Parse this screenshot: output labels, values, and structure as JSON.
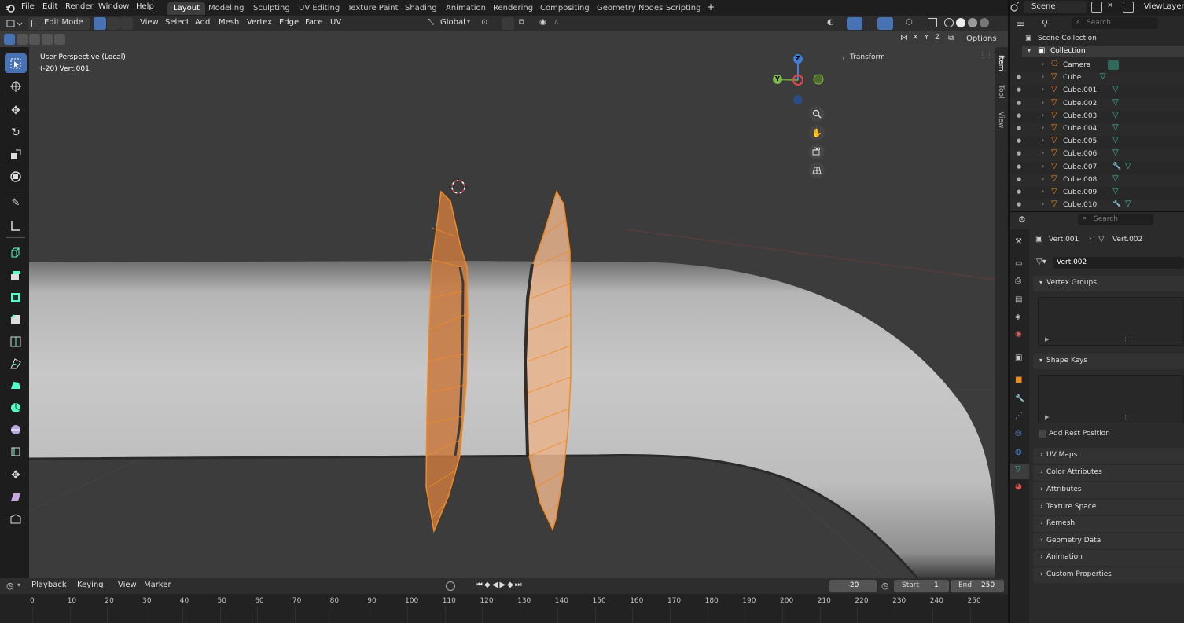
{
  "topbar": {
    "menus": [
      "File",
      "Edit",
      "Render",
      "Window",
      "Help"
    ],
    "workspaces": [
      "Layout",
      "Modeling",
      "Sculpting",
      "UV Editing",
      "Texture Paint",
      "Shading",
      "Animation",
      "Rendering",
      "Compositing",
      "Geometry Nodes",
      "Scripting"
    ],
    "active_workspace": "Layout",
    "add_workspace": "+",
    "scene": "Scene",
    "view_layer": "ViewLayer"
  },
  "viewport_header": {
    "mode": "Edit Mode",
    "menus": [
      "View",
      "Select",
      "Add",
      "Mesh",
      "Vertex",
      "Edge",
      "Face",
      "UV"
    ],
    "orientation": "Global",
    "options": "Options",
    "axes": [
      "X",
      "Y",
      "Z"
    ]
  },
  "viewport": {
    "perspective": "User Perspective (Local)",
    "object_info": "(-20) Vert.001",
    "gizmo": {
      "z": "Z",
      "y": "Y"
    },
    "npanel_section": "Transform",
    "npanel_tabs": [
      "Item",
      "Tool",
      "View"
    ]
  },
  "timeline": {
    "menus": [
      "Playback",
      "Keying",
      "View",
      "Marker"
    ],
    "current_frame": "-20",
    "start_label": "Start",
    "start": "1",
    "end_label": "End",
    "end": "250",
    "ticks": [
      "0",
      "10",
      "20",
      "30",
      "40",
      "50",
      "60",
      "70",
      "80",
      "90",
      "100",
      "110",
      "120",
      "130",
      "140",
      "150",
      "160",
      "170",
      "180",
      "190",
      "200",
      "210",
      "220",
      "230",
      "240",
      "250"
    ]
  },
  "outliner": {
    "search_placeholder": "Search",
    "scene_collection": "Scene Collection",
    "collection": "Collection",
    "items": [
      {
        "name": "Camera",
        "kind": "camera"
      },
      {
        "name": "Cube",
        "kind": "mesh"
      },
      {
        "name": "Cube.001",
        "kind": "mesh"
      },
      {
        "name": "Cube.002",
        "kind": "mesh"
      },
      {
        "name": "Cube.003",
        "kind": "mesh"
      },
      {
        "name": "Cube.004",
        "kind": "mesh"
      },
      {
        "name": "Cube.005",
        "kind": "mesh"
      },
      {
        "name": "Cube.006",
        "kind": "mesh"
      },
      {
        "name": "Cube.007",
        "kind": "mesh-mod"
      },
      {
        "name": "Cube.008",
        "kind": "mesh"
      },
      {
        "name": "Cube.009",
        "kind": "mesh"
      },
      {
        "name": "Cube.010",
        "kind": "mesh-mod"
      }
    ]
  },
  "properties": {
    "search_placeholder": "Search",
    "breadcrumb_object": "Vert.001",
    "breadcrumb_data": "Vert.002",
    "mesh_name": "Vert.002",
    "panels": {
      "vertex_groups": "Vertex Groups",
      "shape_keys": "Shape Keys",
      "add_rest_position": "Add Rest Position",
      "uv_maps": "UV Maps",
      "color_attributes": "Color Attributes",
      "attributes": "Attributes",
      "texture_space": "Texture Space",
      "remesh": "Remesh",
      "geometry_data": "Geometry Data",
      "animation": "Animation",
      "custom_properties": "Custom Properties"
    }
  },
  "colors": {
    "accent": "#4772b3",
    "selection": "#f08a24",
    "mesh_green": "#3fc0a0"
  }
}
